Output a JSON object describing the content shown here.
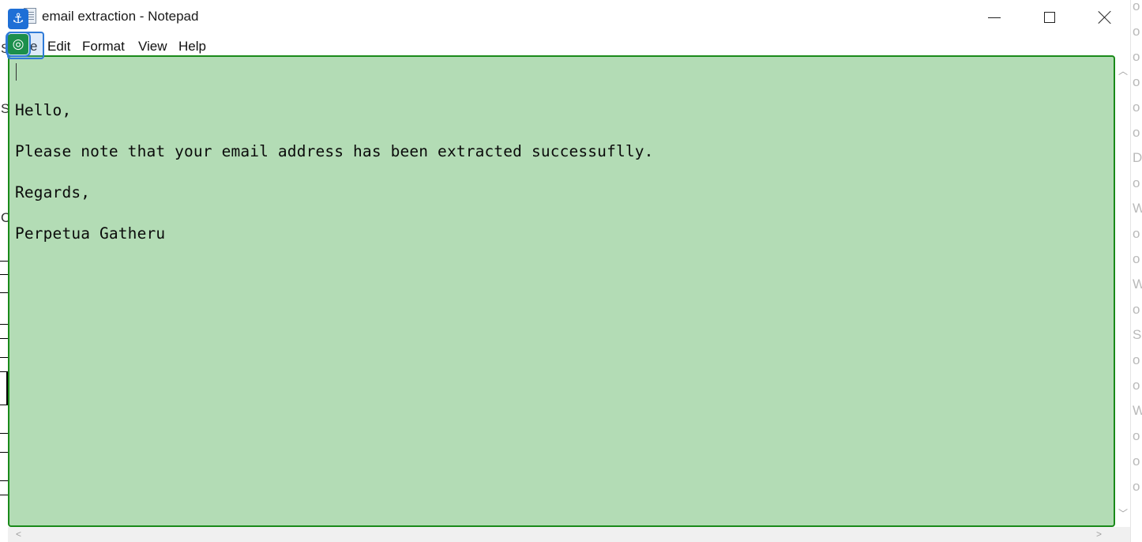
{
  "window": {
    "title": "email extraction - Notepad",
    "app_icon": "notepad-icon",
    "controls": {
      "minimize": "minimize-icon",
      "maximize": "maximize-icon",
      "close": "close-icon"
    }
  },
  "menu": {
    "file": "e",
    "edit": "Edit",
    "format": "Format",
    "view": "View",
    "help": "Help"
  },
  "document": {
    "lines": [
      "Hello,",
      "Please note that your email address has been extracted successuflly.",
      "Regards,",
      "Perpetua Gatheru"
    ]
  },
  "overlay": {
    "anchor_badge_icon": "anchor-icon",
    "target_badge_icon": "target-icon",
    "highlight_color": "#b3dcb5",
    "border_color": "#1a8a1a"
  },
  "background_window": {
    "left_chars": [
      "S",
      "S",
      "C"
    ],
    "right_chars": [
      "o",
      "o",
      "o",
      "o",
      "o",
      "o",
      "D",
      "o",
      "W",
      "o",
      "o",
      "o",
      "W",
      "o",
      "o",
      "S",
      "W",
      "o",
      "o",
      "o"
    ]
  }
}
